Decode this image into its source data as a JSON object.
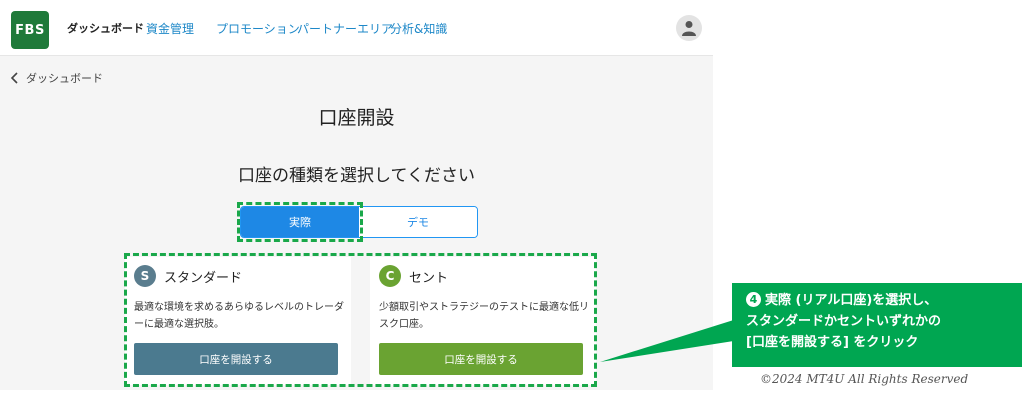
{
  "topbar": {
    "logo_text": "FBS",
    "nav": [
      "ダッシュボード",
      "資金管理",
      "プロモーション",
      "パートナーエリア",
      "分析&知識"
    ],
    "avatar_icon": "user-icon"
  },
  "breadcrumb": {
    "back_label": "ダッシュボード"
  },
  "page": {
    "title": "口座開設",
    "subtitle": "口座の種類を選択してください"
  },
  "account_mode": {
    "options": [
      "実際",
      "デモ"
    ],
    "selected": "実際"
  },
  "cards": [
    {
      "icon_letter": "S",
      "name": "スタンダード",
      "description": "最適な環境を求めるあらゆるレベルのトレーダーに最適な選択肢。",
      "button": "口座を開設する"
    },
    {
      "icon_letter": "C",
      "name": "セント",
      "description": "少額取引やストラテジーのテストに最適な低リスク口座。",
      "button": "口座を開設する"
    }
  ],
  "annotation": {
    "number": "4",
    "lines": [
      "実際 (リアル口座)を選択し、",
      "スタンダードかセントいずれかの",
      "[口座を開設する] をクリック"
    ]
  },
  "copyright": "©2024 MT4U All Rights Reserved",
  "colors": {
    "accent_blue": "#1e88e5",
    "fbs_green": "#1f7a3a",
    "standard_button": "#4b7a8f",
    "cent_button": "#6aa332",
    "highlight_green": "#1aa84a",
    "callout_green": "#00a651"
  }
}
